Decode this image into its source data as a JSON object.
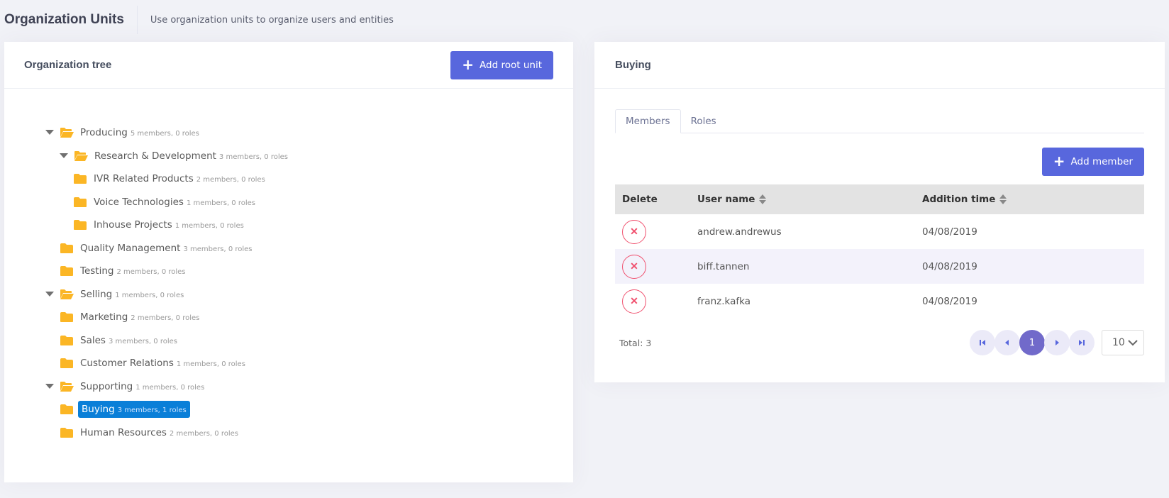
{
  "subheader": {
    "title": "Organization Units",
    "description": "Use organization units to organize users and entities"
  },
  "tree_card": {
    "title": "Organization tree",
    "add_root_label": "Add root unit",
    "nodes": [
      {
        "name": "Producing",
        "meta": "5 members, 0 roles",
        "level": 0,
        "expanded": true
      },
      {
        "name": "Research & Development",
        "meta": "3 members, 0 roles",
        "level": 1,
        "expanded": true
      },
      {
        "name": "IVR Related Products",
        "meta": "2 members, 0 roles",
        "level": 2
      },
      {
        "name": "Voice Technologies",
        "meta": "1 members, 0 roles",
        "level": 2
      },
      {
        "name": "Inhouse Projects",
        "meta": "1 members, 0 roles",
        "level": 2
      },
      {
        "name": "Quality Management",
        "meta": "3 members, 0 roles",
        "level": 1
      },
      {
        "name": "Testing",
        "meta": "2 members, 0 roles",
        "level": 1
      },
      {
        "name": "Selling",
        "meta": "1 members, 0 roles",
        "level": 0,
        "expanded": true
      },
      {
        "name": "Marketing",
        "meta": "2 members, 0 roles",
        "level": 1
      },
      {
        "name": "Sales",
        "meta": "3 members, 0 roles",
        "level": 1
      },
      {
        "name": "Customer Relations",
        "meta": "1 members, 0 roles",
        "level": 1
      },
      {
        "name": "Supporting",
        "meta": "1 members, 0 roles",
        "level": 0,
        "expanded": true
      },
      {
        "name": "Buying",
        "meta": "3 members, 1 roles",
        "level": 1,
        "selected": true
      },
      {
        "name": "Human Resources",
        "meta": "2 members, 0 roles",
        "level": 1
      }
    ]
  },
  "detail_card": {
    "title": "Buying",
    "tabs": [
      {
        "label": "Members",
        "active": true
      },
      {
        "label": "Roles",
        "active": false
      }
    ],
    "add_member_label": "Add member",
    "columns": [
      "Delete",
      "User name",
      "Addition time"
    ],
    "rows": [
      {
        "user": "andrew.andrewus",
        "time": "04/08/2019"
      },
      {
        "user": "biff.tannen",
        "time": "04/08/2019"
      },
      {
        "user": "franz.kafka",
        "time": "04/08/2019"
      }
    ],
    "delete_glyph": "✕",
    "total_label": "Total: 3",
    "pagination": {
      "current_page": "1",
      "page_size": "10"
    }
  },
  "colors": {
    "primary": "#5867dd",
    "selected_node": "#0a7fd8",
    "folder": "#fbb625",
    "danger": "#f0506e",
    "page_current": "#716aca"
  }
}
